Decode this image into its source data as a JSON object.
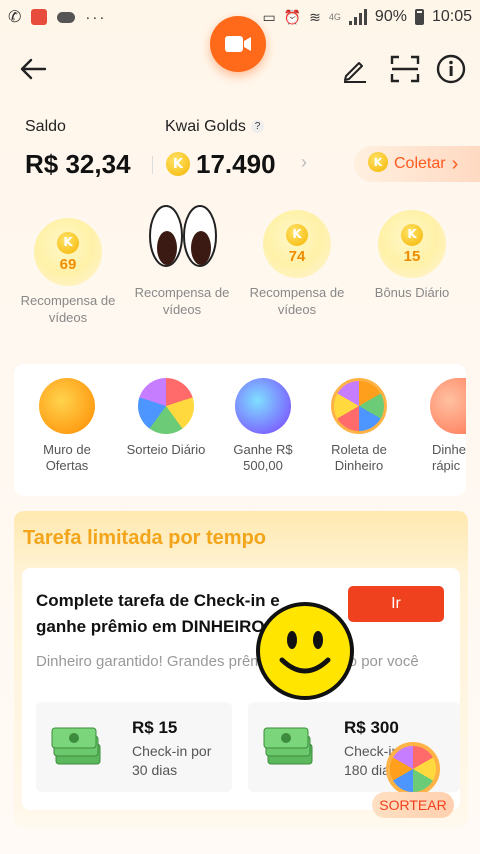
{
  "status_bar": {
    "battery": "90%",
    "time": "10:05",
    "network": "4G"
  },
  "header": {
    "back_icon": "arrow-left-icon",
    "edit_icon": "pencil-icon",
    "scan_icon": "scan-frame-icon",
    "info_icon": "info-icon",
    "camera_icon": "video-camera-icon"
  },
  "balance": {
    "saldo_label": "Saldo",
    "saldo_value": "R$ 32,34",
    "golds_label": "Kwai Golds",
    "golds_help": "?",
    "golds_value": "17.490",
    "golds_arrow": "›",
    "coletar_label": "Coletar",
    "coletar_arrow": "›",
    "coin_letter": "K"
  },
  "rewards": [
    {
      "amount": "69",
      "label": "Recompensa de vídeos"
    },
    {
      "amount": "",
      "label": "Recompensa de vídeos"
    },
    {
      "amount": "74",
      "label": "Recompensa de vídeos"
    },
    {
      "amount": "15",
      "label": "Bônus Diário"
    }
  ],
  "shortcuts": [
    {
      "line1": "Muro de",
      "line2": "Ofertas"
    },
    {
      "line1": "Sorteio Diário",
      "line2": ""
    },
    {
      "line1": "Ganhe R$",
      "line2": "500,00"
    },
    {
      "line1": "Roleta de",
      "line2": "Dinheiro"
    },
    {
      "line1": "Dinhe",
      "line2": "rápic"
    }
  ],
  "task": {
    "title": "Tarefa limitada por tempo",
    "heading_line1": "Complete tarefa de Check-in e",
    "heading_line2": "ganhe prêmio em DINHEIRO",
    "go_button": "Ir",
    "subtitle": "Dinheiro garantido! Grandes prêmios esperando por você",
    "prizes": [
      {
        "amount": "R$ 15",
        "line1": "Check-in por",
        "line2": "30 dias"
      },
      {
        "amount": "R$ 300",
        "line1": "Check-in por",
        "line2": "180 dias"
      }
    ],
    "sortear_label": "SORTEAR"
  },
  "colors": {
    "accent": "#ff6a1a",
    "button_red": "#f0411e",
    "gold": "#f2a51a"
  }
}
